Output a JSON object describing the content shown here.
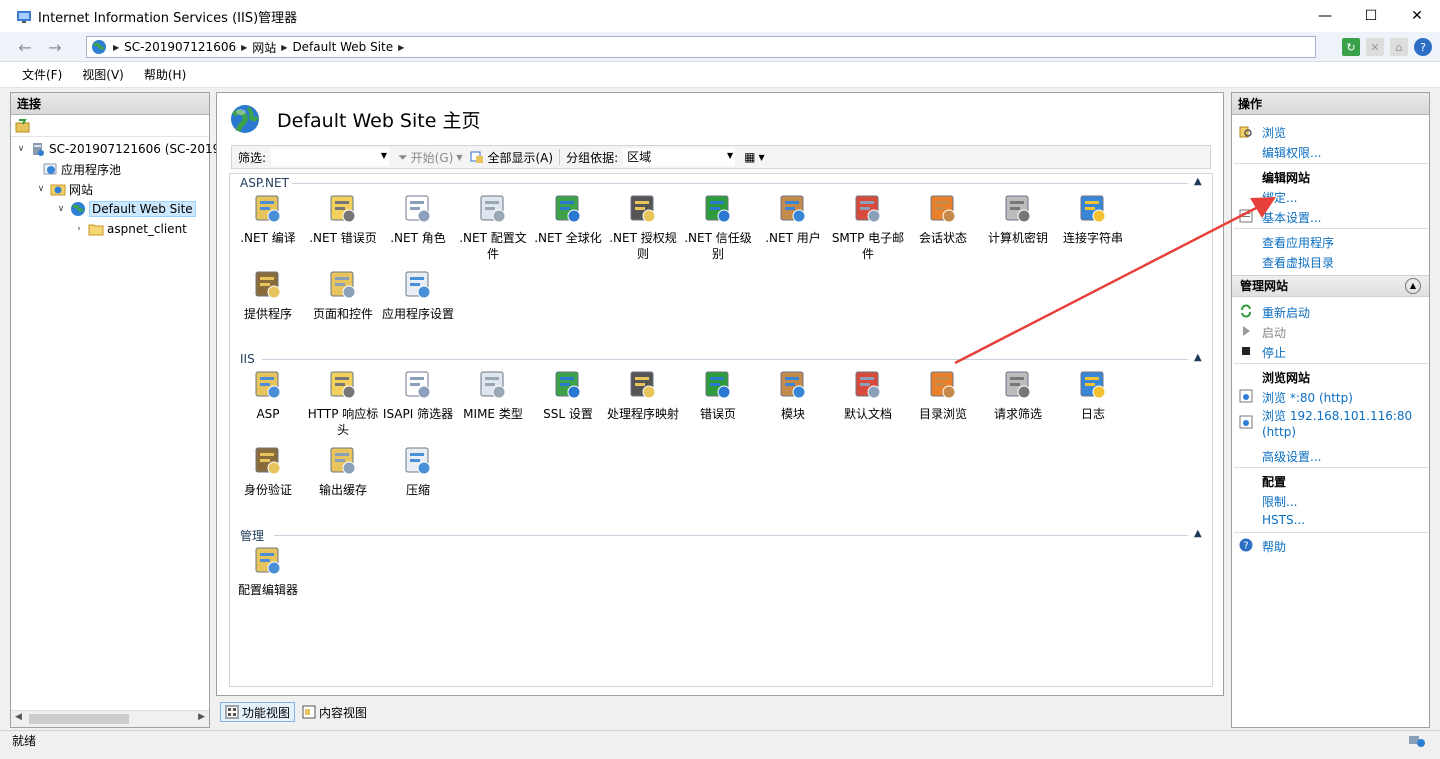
{
  "window": {
    "title": "Internet Information Services (IIS)管理器"
  },
  "address": {
    "crumbs": [
      "SC-201907121606",
      "网站",
      "Default Web Site"
    ]
  },
  "menu": {
    "file": "文件(F)",
    "view": "视图(V)",
    "help": "帮助(H)"
  },
  "connections": {
    "title": "连接",
    "tree": {
      "server": "SC-201907121606 (SC-2019",
      "apppools": "应用程序池",
      "sites": "网站",
      "site": "Default Web Site",
      "child": "aspnet_client"
    }
  },
  "home": {
    "title": "Default Web Site 主页",
    "filter": {
      "label": "筛选:",
      "start": "开始(G)",
      "show_all": "全部显示(A)",
      "group_by": "分组依据:",
      "group_value": "区域"
    }
  },
  "groups": {
    "aspnet": {
      "title": "ASP.NET",
      "items": [
        ".NET 编译",
        ".NET 错误页",
        ".NET 角色",
        ".NET 配置文件",
        ".NET 全球化",
        ".NET 授权规则",
        ".NET 信任级别",
        ".NET 用户",
        "SMTP 电子邮件",
        "会话状态",
        "计算机密钥",
        "连接字符串",
        "提供程序",
        "页面和控件",
        "应用程序设置"
      ]
    },
    "iis": {
      "title": "IIS",
      "items": [
        "ASP",
        "HTTP 响应标头",
        "ISAPI 筛选器",
        "MIME 类型",
        "SSL 设置",
        "处理程序映射",
        "错误页",
        "模块",
        "默认文档",
        "目录浏览",
        "请求筛选",
        "日志",
        "身份验证",
        "输出缓存",
        "压缩"
      ]
    },
    "manage": {
      "title": "管理",
      "items": [
        "配置编辑器"
      ]
    }
  },
  "tabs": {
    "features": "功能视图",
    "content": "内容视图"
  },
  "actions": {
    "title": "操作",
    "browse": "浏览",
    "edit_permissions": "编辑权限...",
    "edit_site": "编辑网站",
    "bindings": "绑定...",
    "basic_settings": "基本设置...",
    "view_apps": "查看应用程序",
    "view_vdirs": "查看虚拟目录",
    "manage_site": "管理网站",
    "restart": "重新启动",
    "start": "启动",
    "stop": "停止",
    "browse_site": "浏览网站",
    "browse_80": "浏览 *:80 (http)",
    "browse_ip_1": "浏览 192.168.101.116:80",
    "browse_ip_2": "(http)",
    "advanced": "高级设置...",
    "config": "配置",
    "limits": "限制...",
    "hsts": "HSTS...",
    "help": "帮助"
  },
  "status": {
    "text": "就绪"
  },
  "colors": {
    "link": "#0b6ec2",
    "arrow": "#e8403b",
    "group": "#1e395b"
  }
}
